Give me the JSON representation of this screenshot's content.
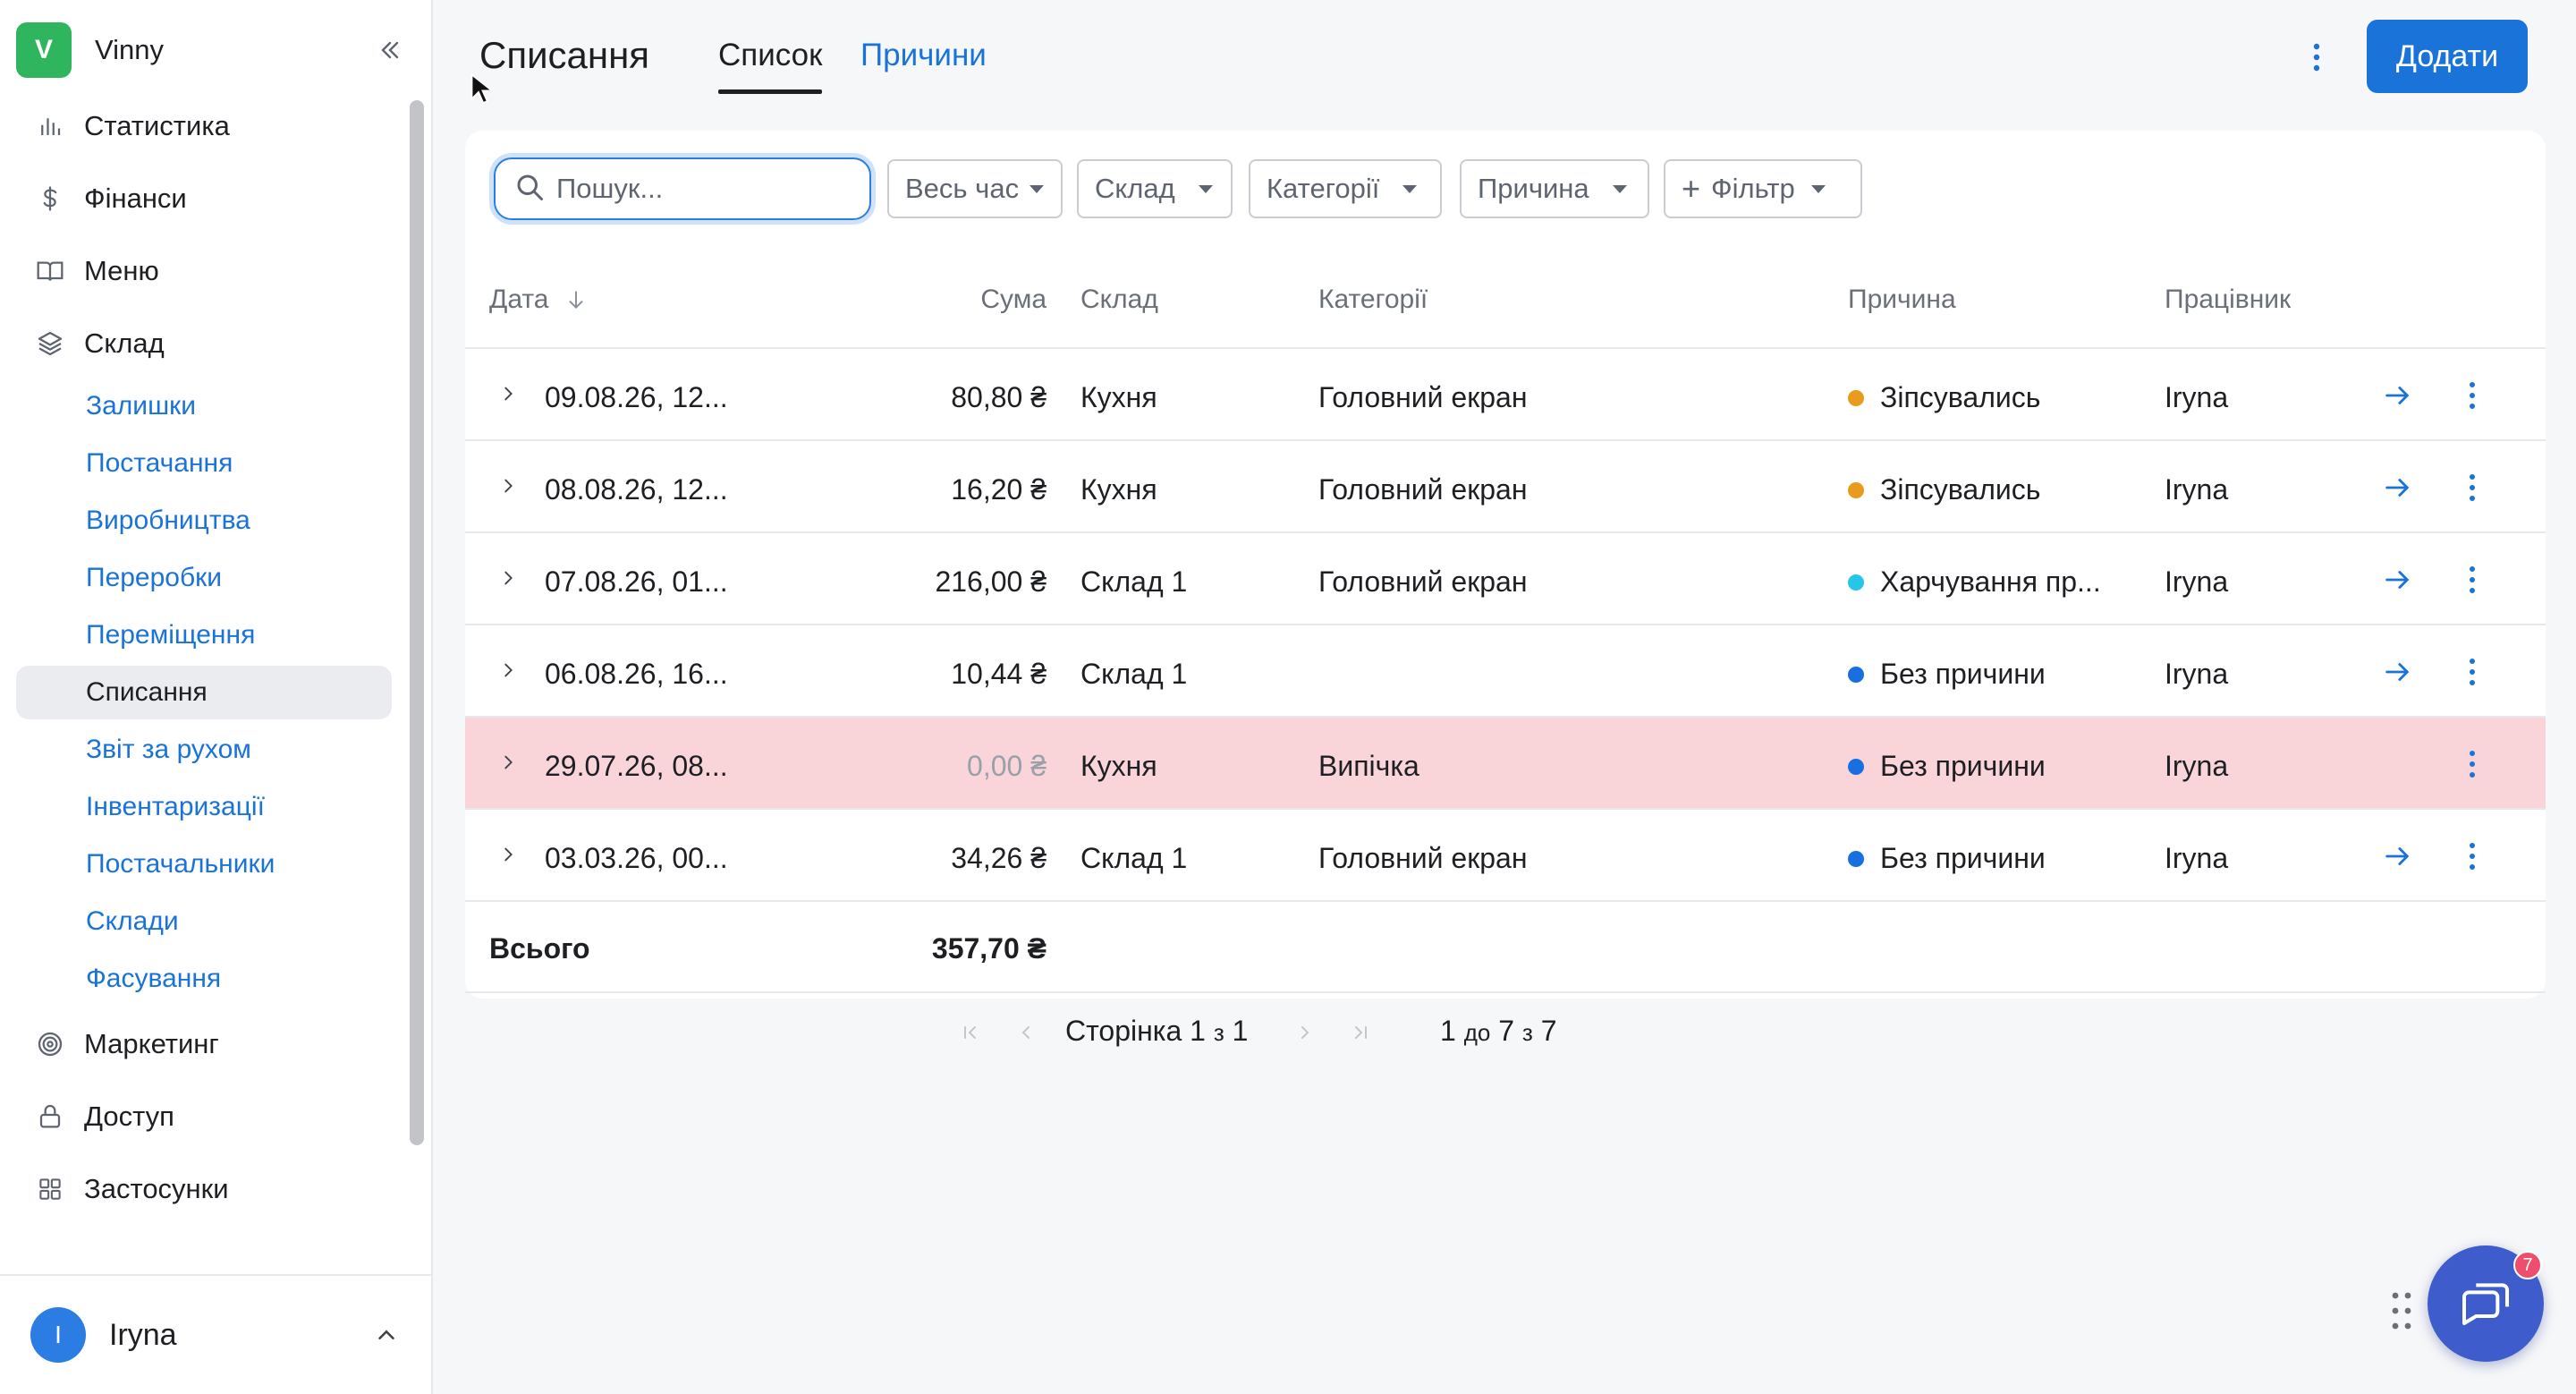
{
  "app": {
    "logo_letter": "V",
    "name": "Vinny"
  },
  "sidebar": {
    "items": [
      {
        "label": "Статистика",
        "icon": "bar-chart-icon"
      },
      {
        "label": "Фінанси",
        "icon": "dollar-icon"
      },
      {
        "label": "Меню",
        "icon": "book-icon"
      },
      {
        "label": "Склад",
        "icon": "layers-icon"
      }
    ],
    "sub_items": [
      {
        "label": "Залишки",
        "active": false
      },
      {
        "label": "Постачання",
        "active": false
      },
      {
        "label": "Виробництва",
        "active": false
      },
      {
        "label": "Переробки",
        "active": false
      },
      {
        "label": "Переміщення",
        "active": false
      },
      {
        "label": "Списання",
        "active": true
      },
      {
        "label": "Звіт за рухом",
        "active": false
      },
      {
        "label": "Інвентаризації",
        "active": false
      },
      {
        "label": "Постачальники",
        "active": false
      },
      {
        "label": "Склади",
        "active": false
      },
      {
        "label": "Фасування",
        "active": false
      }
    ],
    "bottom_items": [
      {
        "label": "Маркетинг",
        "icon": "target-icon"
      },
      {
        "label": "Доступ",
        "icon": "lock-icon"
      },
      {
        "label": "Застосунки",
        "icon": "grid-icon"
      }
    ],
    "user": {
      "initial": "I",
      "name": "Iryna"
    }
  },
  "header": {
    "title": "Списання",
    "tabs": [
      {
        "label": "Список",
        "active": true
      },
      {
        "label": "Причини",
        "active": false
      }
    ],
    "add_label": "Додати"
  },
  "toolbar": {
    "search_placeholder": "Пошук...",
    "filters": [
      "Весь час",
      "Склад",
      "Категорії",
      "Причина"
    ],
    "add_filter_label": "Фільтр"
  },
  "table": {
    "columns": {
      "date": "Дата",
      "sum": "Сума",
      "warehouse": "Склад",
      "categories": "Категорії",
      "reason": "Причина",
      "employee": "Працівник"
    },
    "rows": [
      {
        "date": "09.08.26, 12...",
        "sum": "80,80 ₴",
        "warehouse": "Кухня",
        "categories": "Головний екран",
        "reason": "Зіпсувались",
        "reason_color": "#e89b1c",
        "employee": "Iryna",
        "highlight": false
      },
      {
        "date": "08.08.26, 12...",
        "sum": "16,20 ₴",
        "warehouse": "Кухня",
        "categories": "Головний екран",
        "reason": "Зіпсувались",
        "reason_color": "#e89b1c",
        "employee": "Iryna",
        "highlight": false
      },
      {
        "date": "07.08.26, 01...",
        "sum": "216,00 ₴",
        "warehouse": "Склад 1",
        "categories": "Головний екран",
        "reason": "Харчування пр...",
        "reason_color": "#26c6e8",
        "employee": "Iryna",
        "highlight": false
      },
      {
        "date": "06.08.26, 16...",
        "sum": "10,44 ₴",
        "warehouse": "Склад 1",
        "categories": "",
        "reason": "Без причини",
        "reason_color": "#1a6fe0",
        "employee": "Iryna",
        "highlight": false
      },
      {
        "date": "29.07.26, 08...",
        "sum": "0,00 ₴",
        "warehouse": "Кухня",
        "categories": "Випічка",
        "reason": "Без причини",
        "reason_color": "#1a6fe0",
        "employee": "Iryna",
        "highlight": true
      },
      {
        "date": "03.03.26, 00...",
        "sum": "34,26 ₴",
        "warehouse": "Склад 1",
        "categories": "Головний екран",
        "reason": "Без причини",
        "reason_color": "#1a6fe0",
        "employee": "Iryna",
        "highlight": false
      }
    ],
    "total_label": "Всього",
    "total_sum": "357,70 ₴"
  },
  "pager": {
    "page_word": "Сторінка",
    "page": "1",
    "of_word": "з",
    "pages": "1",
    "range_from": "1",
    "range_to_word": "до",
    "range_to": "7",
    "range_of_word": "з",
    "range_total": "7"
  },
  "chat": {
    "badge": "7"
  },
  "colors": {
    "accent": "#1a73d9",
    "highlight_row": "#f9d5da",
    "logo": "#2fb55d",
    "chat": "#3e5ccb"
  }
}
